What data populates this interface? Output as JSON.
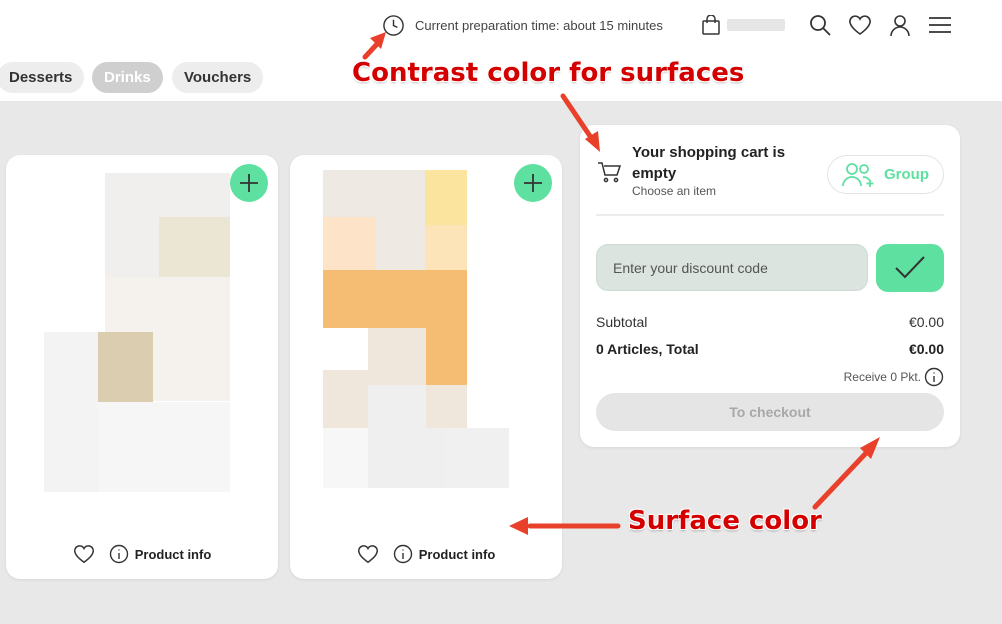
{
  "colors": {
    "accent": "#5ee0a0",
    "surface": "#ffffff",
    "background": "#e8e8e8",
    "annotation": "#d40000",
    "disabled_button": "#e5e5e5",
    "discount_field": "#dbe4de"
  },
  "header": {
    "prep_icon": "clock-icon",
    "prep_text": "Current preparation time: about 15 minutes",
    "icons": [
      "shopping-bag-icon",
      "search-icon",
      "heart-icon",
      "user-icon",
      "menu-icon"
    ]
  },
  "categories": [
    {
      "label": "Desserts",
      "active": false
    },
    {
      "label": "Drinks",
      "active": true
    },
    {
      "label": "Vouchers",
      "active": false
    }
  ],
  "annotations": {
    "contrast": "Contrast color for surfaces",
    "surface": "Surface color"
  },
  "products": [
    {
      "info_label": "Product info",
      "icons": [
        "plus-icon",
        "heart-icon",
        "info-icon"
      ]
    },
    {
      "info_label": "Product info",
      "icons": [
        "plus-icon",
        "heart-icon",
        "info-icon"
      ]
    }
  ],
  "cart": {
    "icon": "cart-icon",
    "title": "Your shopping cart is empty",
    "subtitle": "Choose an item",
    "group_label": "Group",
    "discount_placeholder": "Enter your discount code",
    "subtotal_label": "Subtotal",
    "subtotal_value": "€0.00",
    "total_label": "0 Articles, Total",
    "total_value": "€0.00",
    "points_text": "Receive 0 Pkt.",
    "checkout_label": "To checkout"
  }
}
